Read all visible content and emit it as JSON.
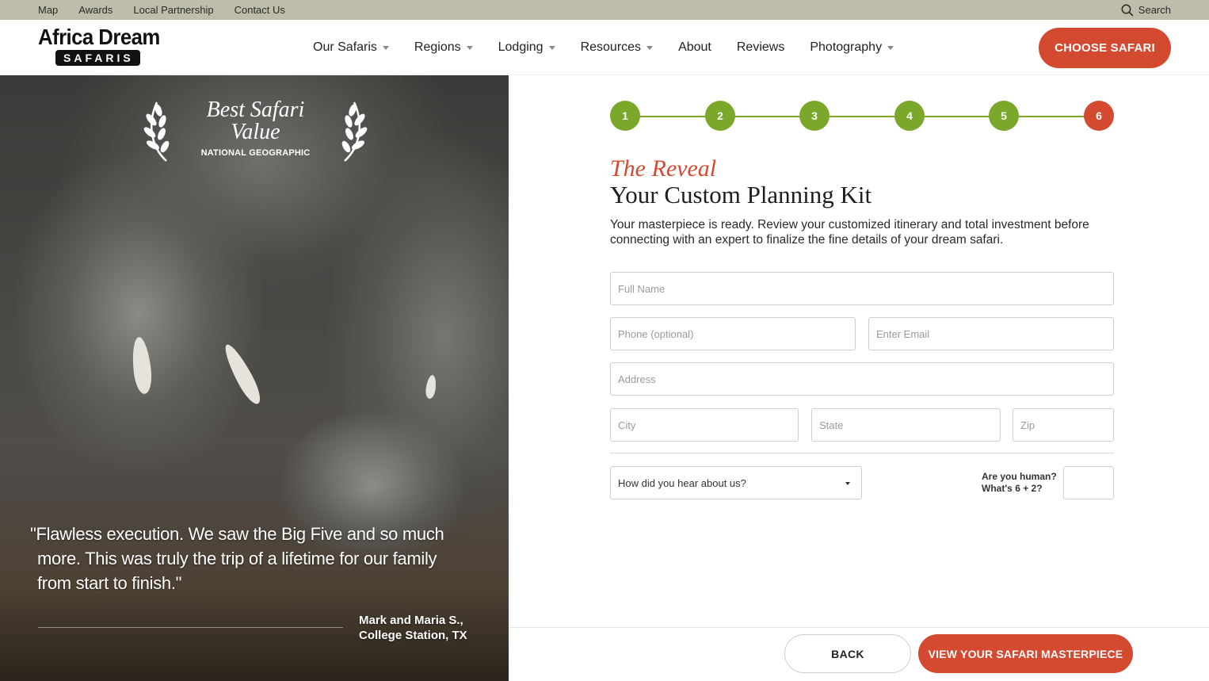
{
  "topbar": {
    "links": [
      "Map",
      "Awards",
      "Local Partnership",
      "Contact Us"
    ],
    "search_label": "Search",
    "search_icon": "search-icon"
  },
  "header": {
    "logo_line1": "Africa Dream",
    "logo_line2": "SAFARIS",
    "nav": [
      {
        "label": "Our Safaris",
        "has_dropdown": true
      },
      {
        "label": "Regions",
        "has_dropdown": true
      },
      {
        "label": "Lodging",
        "has_dropdown": true
      },
      {
        "label": "Resources",
        "has_dropdown": true
      },
      {
        "label": "About",
        "has_dropdown": false
      },
      {
        "label": "Reviews",
        "has_dropdown": false
      },
      {
        "label": "Photography",
        "has_dropdown": true
      }
    ],
    "cta_label": "CHOOSE SAFARI"
  },
  "hero": {
    "award_line1": "Best Safari",
    "award_line2": "Value",
    "award_source": "NATIONAL GEOGRAPHIC",
    "quote_lines": [
      "\"Flawless execution. We saw the Big Five and so much",
      "more. This was truly the trip of a lifetime for our family",
      "from start to finish.\""
    ],
    "attribution_name": "Mark and Maria S.,",
    "attribution_place": "College Station, TX"
  },
  "progress": {
    "steps": [
      "1",
      "2",
      "3",
      "4",
      "5",
      "6"
    ],
    "current_step": 6,
    "complete_color": "#7ba72b",
    "active_color": "#d44a30"
  },
  "form": {
    "eyebrow": "The Reveal",
    "title": "Your Custom Planning Kit",
    "lead": "Your masterpiece is ready. Review your customized itinerary and total investment before connecting with an expert to finalize the fine details of your dream safari.",
    "full_name_placeholder": "Full Name",
    "phone_placeholder": "Phone (optional)",
    "email_placeholder": "Enter Email",
    "address_placeholder": "Address",
    "city_placeholder": "City",
    "state_placeholder": "State",
    "zip_placeholder": "Zip",
    "referral_select": "How did you hear about us?",
    "captcha_line1": "Are you human?",
    "captcha_line2": "What's 6 + 2?",
    "back_label": "BACK",
    "submit_label": "VIEW YOUR SAFARI MASTERPIECE"
  },
  "colors": {
    "accent": "#d44a30",
    "step_green": "#7ba72b",
    "topbar_bg": "#bdbda9"
  }
}
